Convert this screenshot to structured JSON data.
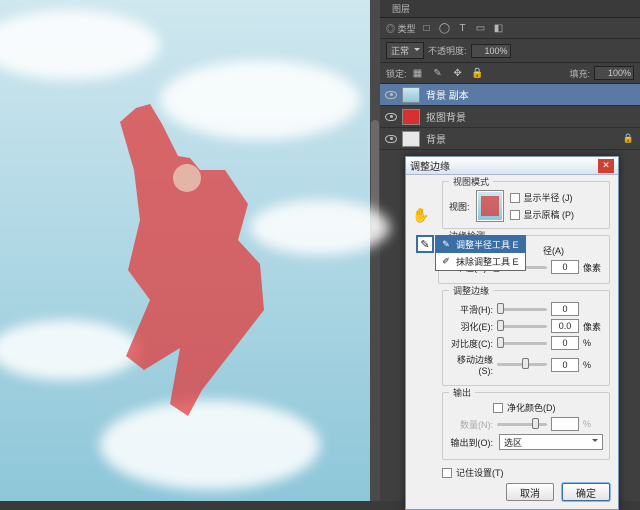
{
  "panel": {
    "tab_layers": "图层",
    "tabs_misc": [
      "◎ 类型",
      "□",
      "◯",
      "T",
      "▭",
      "◧"
    ],
    "blend_mode": "正常",
    "opacity_label": "不透明度:",
    "opacity_value": "100%",
    "lock_label": "锁定:",
    "fill_label": "填充:",
    "fill_value": "100%",
    "layers": [
      {
        "name": "背景 副本",
        "thumb": "sky",
        "locked": false
      },
      {
        "name": "抠图背景",
        "thumb": "red",
        "locked": false
      },
      {
        "name": "背景",
        "thumb": "white",
        "locked": true
      }
    ]
  },
  "dialog": {
    "title": "调整边缘",
    "view_mode_group": "视图模式",
    "show_radius": "显示半径 (J)",
    "show_original": "显示原稿 (P)",
    "view_label": "视图:",
    "edge_detect_group": "边缘检测",
    "smart_radius": "智能半径",
    "radius_tool": "调整半径工具   E",
    "erase_tool": "抹除调整工具   E",
    "radius_a": "径(A)",
    "radius_label": "半径(U):",
    "radius_value": "0",
    "px": "像素",
    "adjust_edge_group": "调整边缘",
    "smooth_label": "平滑(H):",
    "smooth_value": "0",
    "feather_label": "羽化(E):",
    "feather_value": "0.0",
    "contrast_label": "对比度(C):",
    "contrast_value": "0",
    "pct": "%",
    "shift_label": "移动边缘(S):",
    "shift_value": "0",
    "output_group": "输出",
    "decontaminate": "净化颜色(D)",
    "amount_label": "数量(N):",
    "amount_value": "",
    "output_to_label": "输出到(O):",
    "output_to_value": "选区",
    "remember": "记住设置(T)",
    "cancel": "取消",
    "ok": "确定"
  }
}
